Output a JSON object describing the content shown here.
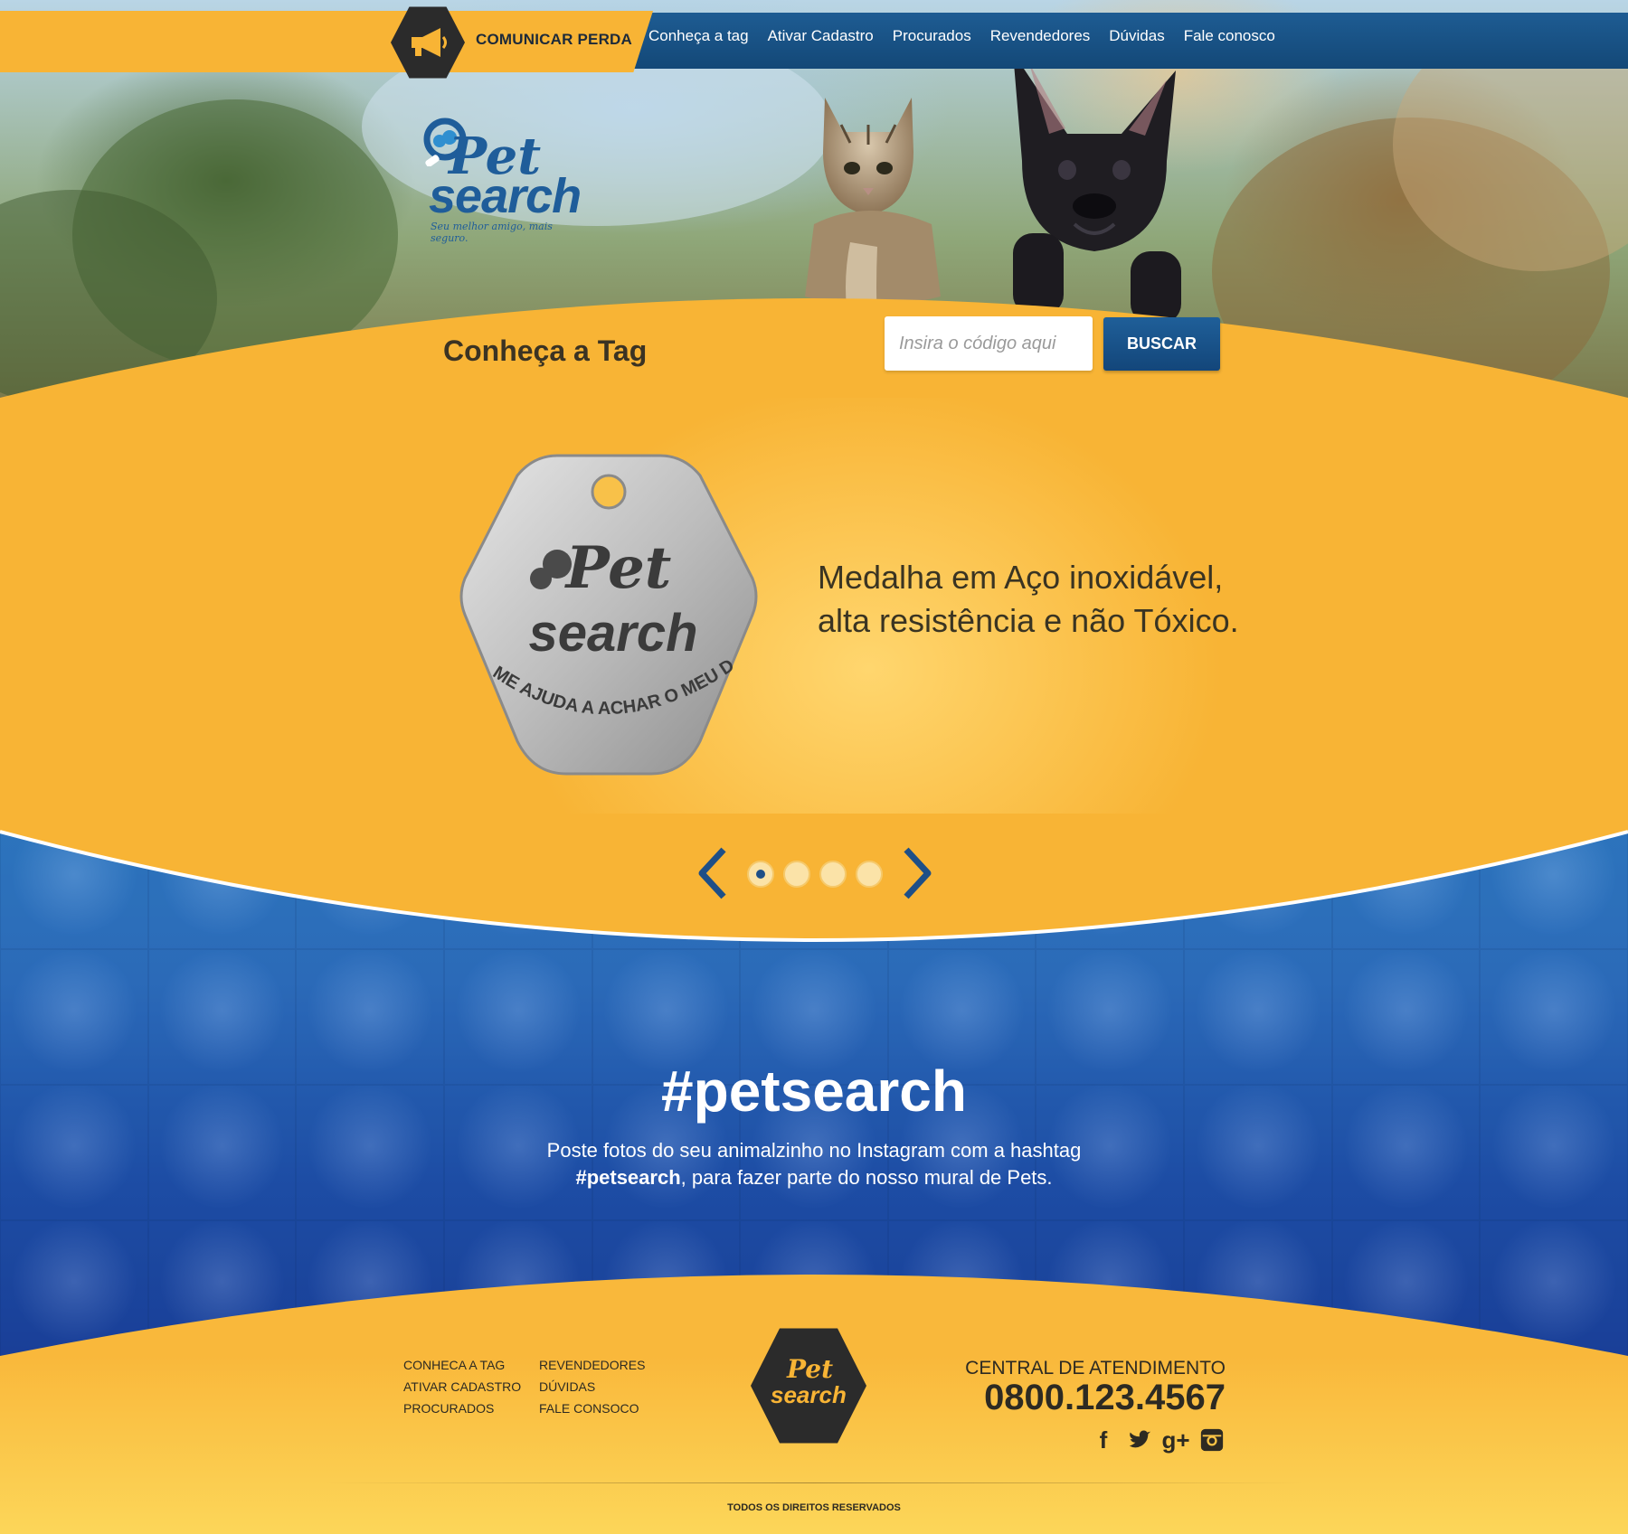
{
  "header": {
    "report_label": "COMUNICAR PERDA",
    "nav": [
      {
        "label": "Conheça a tag"
      },
      {
        "label": "Ativar Cadastro"
      },
      {
        "label": "Procurados"
      },
      {
        "label": "Revendedores"
      },
      {
        "label": "Dúvidas"
      },
      {
        "label": "Fale conosco"
      }
    ]
  },
  "logo": {
    "pet": "Pet",
    "search": "search",
    "slogan": "Seu melhor amigo, mais seguro."
  },
  "search": {
    "section_title": "Conheça a Tag",
    "placeholder": "Insira o código aqui",
    "button_label": "BUSCAR"
  },
  "slider": {
    "medal_text_pet": "Pet",
    "medal_text_search": "search",
    "medal_ring": "ME AJUDA A ACHAR O MEU DONO?",
    "line1": "Medalha em Aço inoxidável,",
    "line2": "alta resistência e não Tóxico.",
    "dots": 4,
    "active_dot": 1
  },
  "instagram": {
    "hashtag": "#petsearch",
    "text_line1": "Poste fotos do seu animalzinho no Instagram com a hashtag",
    "text_bold": "#petsearch",
    "text_line2_rest": ", para fazer parte do nosso mural de Pets."
  },
  "footer": {
    "col1": [
      "CONHECA A TAG",
      "ATIVAR CADASTRO",
      "PROCURADOS"
    ],
    "col2": [
      "REVENDEDORES",
      "DÚVIDAS",
      "FALE CONSOCO"
    ],
    "logo_pet": "Pet",
    "logo_search": "search",
    "central_label": "CENTRAL DE ATENDIMENTO",
    "phone": "0800.123.4567",
    "social": [
      {
        "name": "facebook-icon",
        "glyph": "f"
      },
      {
        "name": "twitter-icon",
        "glyph": "t"
      },
      {
        "name": "google-plus-icon",
        "glyph": "g+"
      },
      {
        "name": "instagram-icon",
        "glyph": "◘"
      }
    ],
    "copyright": "TODOS OS DIREITOS RESERVADOS"
  },
  "colors": {
    "orange": "#f8b435",
    "blue": "#1e5c93",
    "dark": "#2b2b2b"
  }
}
